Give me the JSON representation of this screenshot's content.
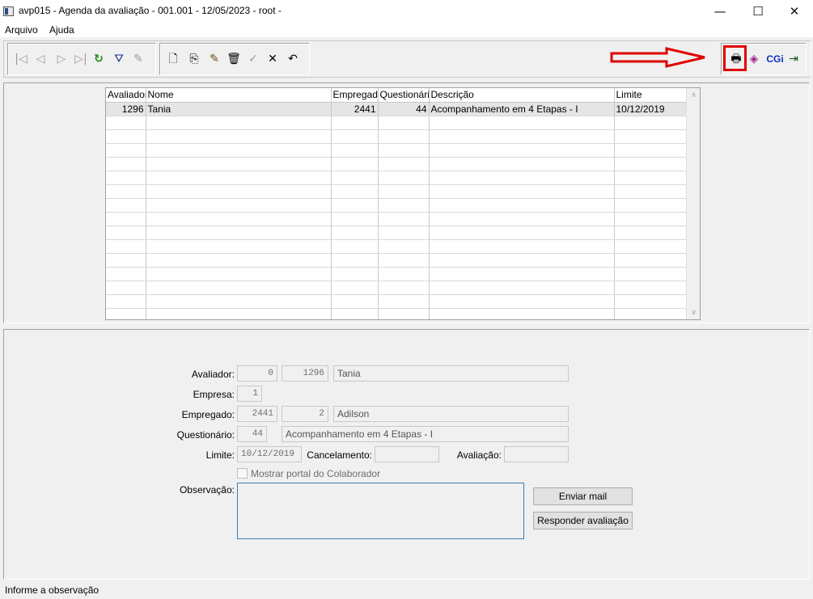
{
  "window": {
    "title": "avp015 - Agenda da avaliação - 001.001 - 12/05/2023 - root -",
    "minimize": "—",
    "maximize": "☐",
    "close": "✕"
  },
  "menu": [
    "Arquivo",
    "Ajuda"
  ],
  "toolbar": {
    "nav": [
      {
        "name": "first-record-icon",
        "glyph": "|◁"
      },
      {
        "name": "previous-record-icon",
        "glyph": "◁"
      },
      {
        "name": "next-record-icon",
        "glyph": "▷"
      },
      {
        "name": "last-record-icon",
        "glyph": "▷|"
      },
      {
        "name": "refresh-icon",
        "glyph": "↻"
      },
      {
        "name": "filter-icon",
        "glyph": "⛛"
      },
      {
        "name": "search-icon",
        "glyph": "✎"
      }
    ],
    "edit": [
      {
        "name": "new-record-icon",
        "glyph": "🗋"
      },
      {
        "name": "copy-record-icon",
        "glyph": "⎘"
      },
      {
        "name": "edit-record-icon",
        "glyph": "✎"
      },
      {
        "name": "delete-record-icon",
        "glyph": "🗑"
      },
      {
        "name": "confirm-icon",
        "glyph": "✓"
      },
      {
        "name": "cancel-icon",
        "glyph": "✕"
      },
      {
        "name": "undo-icon",
        "glyph": "↶"
      }
    ],
    "right": [
      {
        "name": "print-icon",
        "glyph": "🖶"
      },
      {
        "name": "book-icon",
        "glyph": "◈"
      },
      {
        "name": "cgi-icon",
        "glyph": "CGi"
      },
      {
        "name": "exit-icon",
        "glyph": "⇥"
      }
    ],
    "annotation_color": "#e00000"
  },
  "grid": {
    "columns": [
      "Avaliador",
      "Nome",
      "Empregado",
      "Questionário",
      "Descrição",
      "Limite"
    ],
    "rows": [
      [
        "1296",
        "Tania",
        "2441",
        "44",
        "Acompanhamento em 4 Etapas - I",
        "10/12/2019"
      ]
    ],
    "empty_rows": 15,
    "scroll_up": "∧",
    "scroll_down": "∨"
  },
  "form": {
    "avaliador": {
      "label": "Avaliador:",
      "code1": "0",
      "code2": "1296",
      "name": "Tania"
    },
    "empresa": {
      "label": "Empresa:",
      "value": "1"
    },
    "empregado": {
      "label": "Empregado:",
      "code1": "2441",
      "code2": "2",
      "name": "Adilson"
    },
    "questionario": {
      "label": "Questionário:",
      "code": "44",
      "name": "Acompanhamento em 4 Etapas - I"
    },
    "limite": {
      "label": "Limite:",
      "value": "10/12/2019"
    },
    "cancelamento": {
      "label": "Cancelamento:",
      "value": ""
    },
    "avaliacao": {
      "label": "Avaliação:",
      "value": ""
    },
    "portal_checkbox": {
      "label": "Mostrar portal do Colaborador",
      "checked": false
    },
    "observacao": {
      "label": "Observação:",
      "value": ""
    },
    "enviar_mail": "Enviar mail",
    "responder": "Responder avaliação"
  },
  "status": "Informe a observação"
}
